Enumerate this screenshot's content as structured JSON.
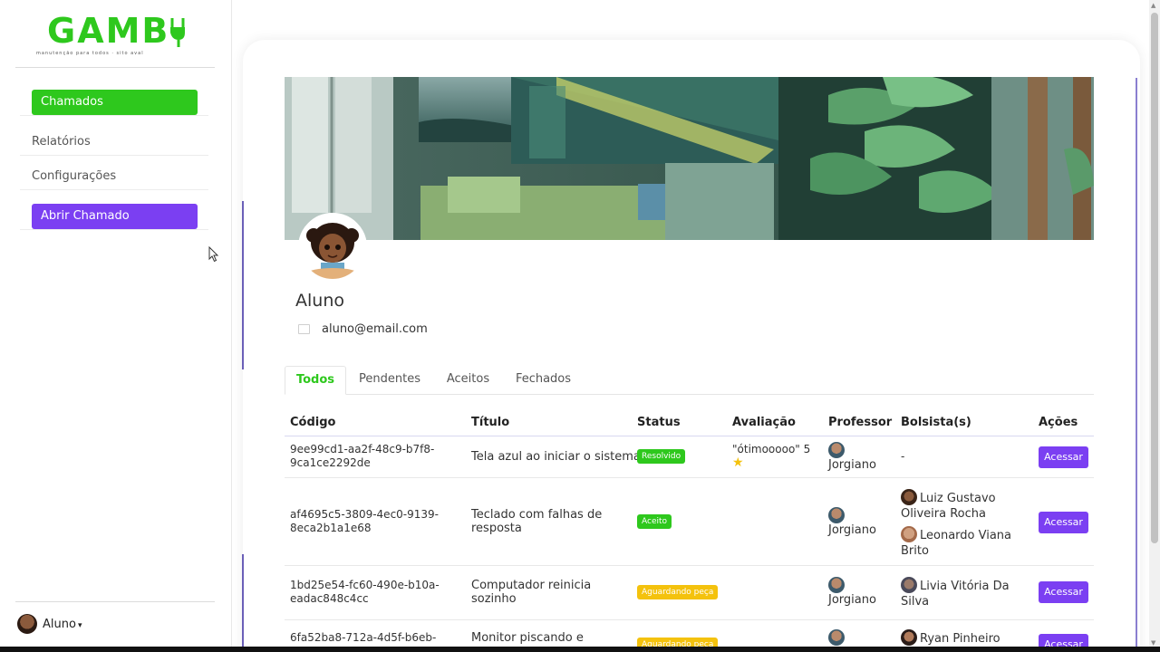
{
  "brand": {
    "logo_text": "GAMB",
    "tagline": "manutenção para todos · sito aval",
    "accent_green": "#2ec81d",
    "accent_purple": "#7b3ff2"
  },
  "sidebar": {
    "items": [
      {
        "label": "Chamados",
        "style": "green-button"
      },
      {
        "label": "Relatórios",
        "style": "link"
      },
      {
        "label": "Configurações",
        "style": "link"
      },
      {
        "label": "Abrir Chamado",
        "style": "purple-button"
      }
    ],
    "user": {
      "name": "Aluno"
    }
  },
  "profile": {
    "name": "Aluno",
    "email": "aluno@email.com"
  },
  "tabs": [
    {
      "label": "Todos",
      "active": true
    },
    {
      "label": "Pendentes",
      "active": false
    },
    {
      "label": "Aceitos",
      "active": false
    },
    {
      "label": "Fechados",
      "active": false
    }
  ],
  "table": {
    "headers": [
      "Código",
      "Título",
      "Status",
      "Avaliação",
      "Professor",
      "Bolsista(s)",
      "Ações"
    ],
    "rows": [
      {
        "code_line1": "9ee99cd1-aa2f-48c9-b7f8-",
        "code_line2": "9ca1ce2292de",
        "title_line1": "Tela azul ao iniciar o sistema",
        "title_line2": "",
        "status": "Resolvido",
        "status_color": "#2ec81d",
        "rating_text": "\"ótimooooo\" 5",
        "rating_stars": "★",
        "professor": "Jorgiano",
        "bolsista1": "-",
        "bolsista2": "",
        "action": "Acessar"
      },
      {
        "code_line1": "af4695c5-3809-4ec0-9139-",
        "code_line2": "8eca2b1a1e68",
        "title_line1": "Teclado com falhas de",
        "title_line2": "resposta",
        "status": "Aceito",
        "status_color": "#2ec81d",
        "rating_text": "",
        "rating_stars": "",
        "professor": "Jorgiano",
        "bolsista1_a": "Luiz Gustavo",
        "bolsista1_b": "Oliveira Rocha",
        "bolsista2_a": "Leonardo Viana",
        "bolsista2_b": "Brito",
        "action": "Acessar"
      },
      {
        "code_line1": "1bd25e54-fc60-490e-b10a-",
        "code_line2": "eadac848c4cc",
        "title_line1": "Computador reinicia",
        "title_line2": "sozinho",
        "status": "Aguardando peça",
        "status_color": "#f4c20d",
        "professor": "Jorgiano",
        "bolsista1_a": "Livia Vitória Da",
        "bolsista1_b": "Silva",
        "action": "Acessar"
      },
      {
        "code_line1": "6fa52ba8-712a-4d5f-b6eb-",
        "title_line1": "Monitor piscando e",
        "status": "Aguardando peça",
        "status_color": "#f4c20d",
        "bolsista1_a": "Ryan Pinheiro",
        "action": "Acessar"
      }
    ]
  }
}
